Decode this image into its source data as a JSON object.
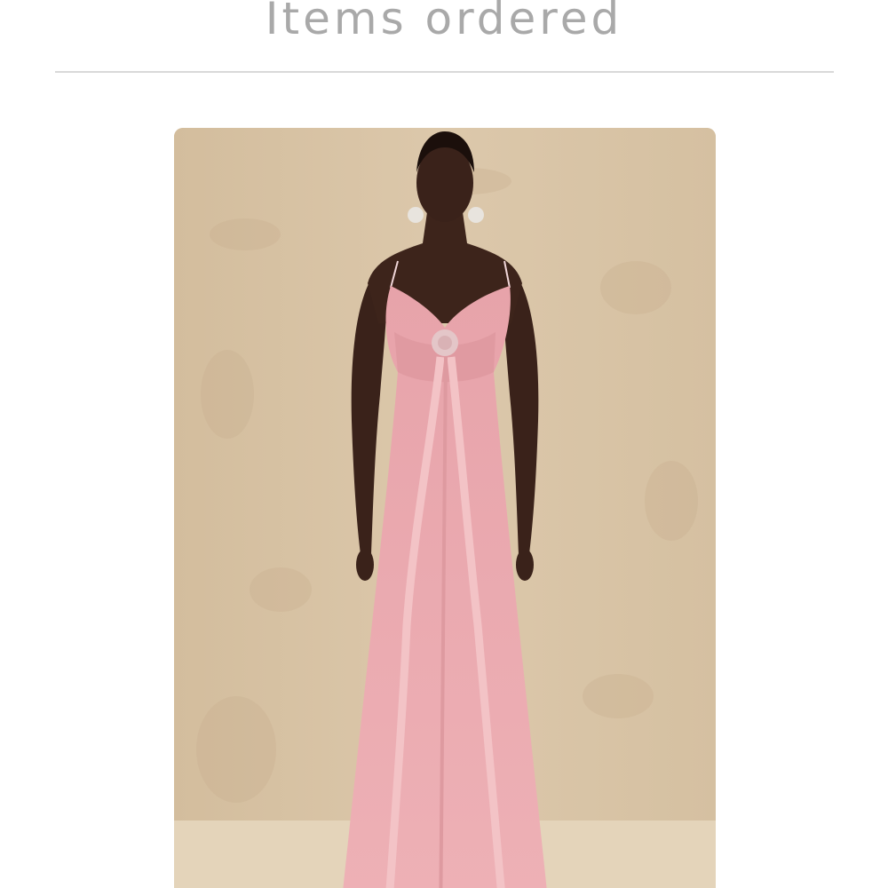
{
  "order": {
    "section_title": "Items ordered"
  },
  "items": [
    {
      "image_icon": "product-photo-pink-ruffled-maxi-dress",
      "colors": {
        "backdrop": "#d8c4a6",
        "dress": "#e9a6ad",
        "skin": "#3a221a"
      }
    }
  ]
}
